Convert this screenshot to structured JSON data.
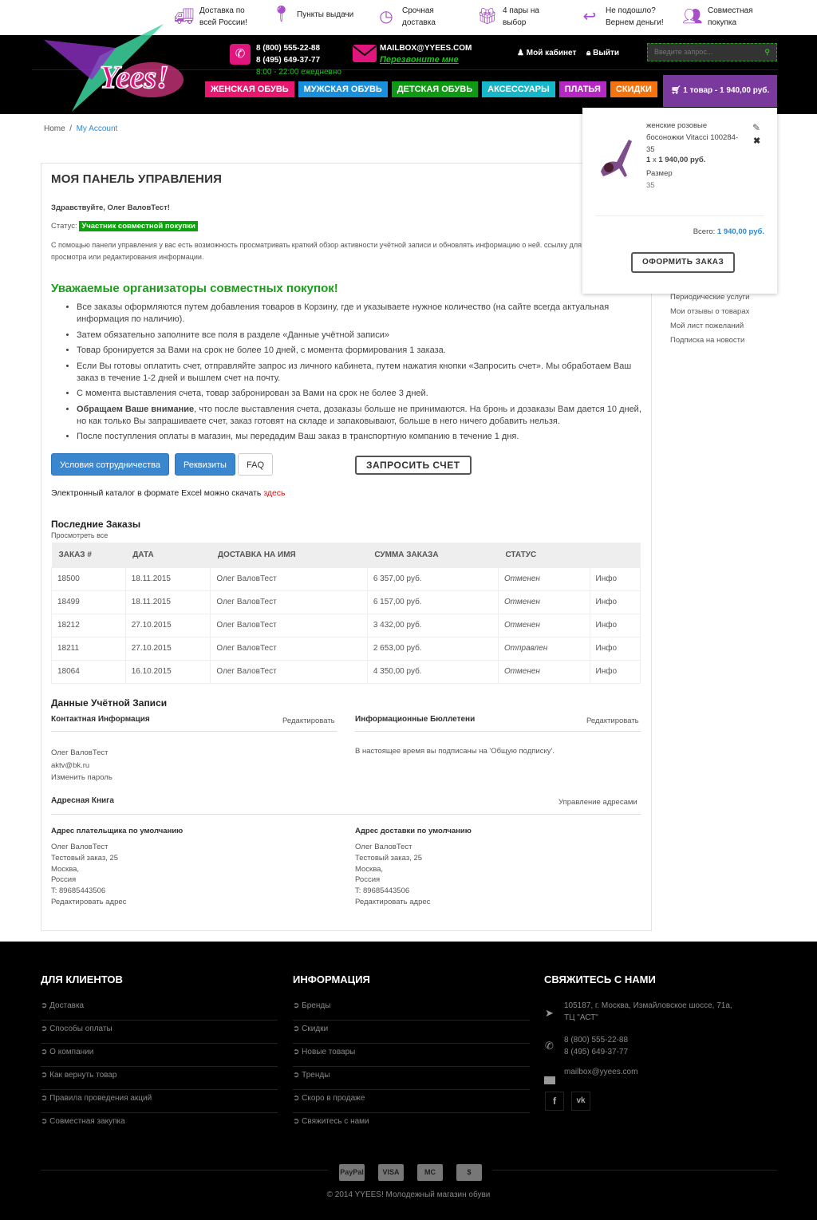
{
  "features": [
    {
      "icon": "truck-icon",
      "text": "Доставка по\nвсей России!"
    },
    {
      "icon": "map-pin-icon",
      "text": "Пункты выдачи"
    },
    {
      "icon": "clock-icon",
      "text": "Срочная\nдоставка"
    },
    {
      "icon": "gift-icon",
      "text": "4 пары на\nвыбор"
    },
    {
      "icon": "return-arrow-icon",
      "text": "Не подошло?\nВернем деньги!"
    },
    {
      "icon": "group-icon",
      "text": "Совместная\nпокупка"
    }
  ],
  "header": {
    "logo": "Yees!",
    "phone1": "8 (800) 555-22-88",
    "phone2": "8 (495) 649-37-77",
    "hours": "8:00 - 22:00 ежедневно",
    "email": "MAILBOX@YYEES.COM",
    "callback": "Перезвоните мне",
    "cabinet": "Мой кабинет",
    "logout": "Выйти",
    "search_placeholder": "Введите запрос...",
    "cart": "1 товар - 1 940,00 руб."
  },
  "nav": [
    {
      "label": "ЖЕНСКАЯ ОБУВЬ",
      "color": "#e8176f"
    },
    {
      "label": "МУЖСКАЯ ОБУВЬ",
      "color": "#1a8fdc"
    },
    {
      "label": "ДЕТСКАЯ ОБУВЬ",
      "color": "#0e9a12"
    },
    {
      "label": "АКСЕССУАРЫ",
      "color": "#17b7c9"
    },
    {
      "label": "ПЛАТЬЯ",
      "color": "#b628c4"
    },
    {
      "label": "СКИДКИ",
      "color": "#f4730e"
    }
  ],
  "breadcrumb": {
    "home": "Home",
    "sep": "/",
    "current": "My Account"
  },
  "cart_dropdown": {
    "name": "женские розовые босоножки Vitacci 100284-35",
    "qty": "1",
    "x": "x",
    "price": "1 940,00 руб.",
    "size_label": "Размер",
    "size": "35",
    "total_label": "Всего:",
    "total": "1 940,00 руб.",
    "checkout": "ОФОРМИТЬ ЗАКАЗ"
  },
  "sidebar": [
    "Периодические услуги",
    "Мои отзывы о товарах",
    "Мой лист пожеланий",
    "Подписка на новости"
  ],
  "main": {
    "title": "МОЯ ПАНЕЛЬ УПРАВЛЕНИЯ",
    "greeting": "Здравствуйте, Олег ВаловТест!",
    "status_label": "Статус:",
    "status": "Участник совместной покупки",
    "intro": "С помощью панели управления у вас есть возможность просматривать краткий обзор активности учётной записи и обновлять информацию о ней. ссылку для просмотра или редактирования информации.",
    "org_title": "Уважаемые организаторы совместных покупок!",
    "rules": [
      {
        "b": "",
        "t": "Все заказы оформляются путем добавления товаров в Корзину, где и указываете нужное количество (на сайте всегда актуальная информация по наличию)."
      },
      {
        "b": "",
        "t": "Затем обязательно заполните все поля в разделе «Данные учётной записи»"
      },
      {
        "b": "",
        "t": "Товар бронируется за Вами на срок не более 10 дней, с момента формирования 1 заказа."
      },
      {
        "b": "",
        "t": "Если Вы готовы оплатить счет, отправляйте запрос из личного кабинета, путем нажатия кнопки «Запросить счет». Мы обработаем Ваш заказ в течение 1-2 дней и вышлем счет на почту."
      },
      {
        "b": "",
        "t": "С момента выставления счета, товар забронирован за Вами на срок не более 3 дней."
      },
      {
        "b": "Обращаем Ваше внимание",
        "t": ", что после выставления счета, дозаказы больше не принимаются. На бронь и дозаказы Вам дается 10 дней, но как только Вы запрашиваете счет, заказ готовят на складе и запаковывают, больше в него ничего добавить нельзя."
      },
      {
        "b": "",
        "t": "После поступления оплаты в магазин, мы передадим Ваш заказ в транспортную компанию в течение 1 дня."
      }
    ],
    "btn_terms": "Условия сотрудничества",
    "btn_req": "Реквизиты",
    "btn_faq": "FAQ",
    "btn_invoice": "ЗАПРОСИТЬ СЧЕТ",
    "catalog_text": "Электронный каталог в формате Excel можно скачать ",
    "catalog_link": "здесь",
    "orders_title": "Последние Заказы",
    "view_all": "Просмотреть все",
    "columns": [
      "ЗАКАЗ #",
      "ДАТА",
      "ДОСТАВКА НА ИМЯ",
      "СУММА ЗАКАЗА",
      "СТАТУС",
      ""
    ],
    "orders": [
      [
        "18500",
        "18.11.2015",
        "Олег ВаловТест",
        "6 357,00 руб.",
        "Отменен",
        "Инфо"
      ],
      [
        "18499",
        "18.11.2015",
        "Олег ВаловТест",
        "6 157,00 руб.",
        "Отменен",
        "Инфо"
      ],
      [
        "18212",
        "27.10.2015",
        "Олег ВаловТест",
        "3 432,00 руб.",
        "Отменен",
        "Инфо"
      ],
      [
        "18211",
        "27.10.2015",
        "Олег ВаловТест",
        "2 653,00 руб.",
        "Отправлен",
        "Инфо"
      ],
      [
        "18064",
        "16.10.2015",
        "Олег ВаловТест",
        "4 350,00 руб.",
        "Отменен",
        "Инфо"
      ]
    ],
    "account_title": "Данные Учётной Записи",
    "contact_title": "Контактная Информация",
    "edit": "Редактировать",
    "contact_name": "Олег ВаловТест",
    "contact_email": "aktv@bk.ru",
    "change_pw": "Изменить пароль",
    "news_title": "Информационные Бюллетени",
    "news_text": "В настоящее время вы подписаны на 'Общую подписку'.",
    "addr_title": "Адресная Книга",
    "addr_manage": "Управление адресами",
    "billing_title": "Адрес плательщика по умолчанию",
    "shipping_title": "Адрес доставки по умолчанию",
    "address": [
      "Олег ВаловТест",
      "Тестовый заказ, 25",
      "Москва,",
      "Россия",
      "T: 89685443506"
    ],
    "edit_addr": "Редактировать адрес"
  },
  "footer": {
    "col1_title": "ДЛЯ КЛИЕНТОВ",
    "col1": [
      "Доставка",
      "Способы оплаты",
      "О компании",
      "Как вернуть товар",
      "Правила проведения акций",
      "Совместная закупка"
    ],
    "col2_title": "ИНФОРМАЦИЯ",
    "col2": [
      "Бренды",
      "Скидки",
      "Новые товары",
      "Тренды",
      "Скоро в продаже",
      "Свяжитесь с нами"
    ],
    "col3_title": "СВЯЖИТЕСЬ С НАМИ",
    "address": "105187, г. Москва, Измайловское шоссе, 71а, ТЦ \"АСТ\"",
    "phone1": "8 (800) 555-22-88",
    "phone2": "8 (495) 649-37-77",
    "email": "mailbox@yyees.com",
    "payments": [
      "PayPal",
      "VISA",
      "MC",
      "$"
    ],
    "copyright": "© 2014 YYEES! Молодежный магазин обуви"
  }
}
